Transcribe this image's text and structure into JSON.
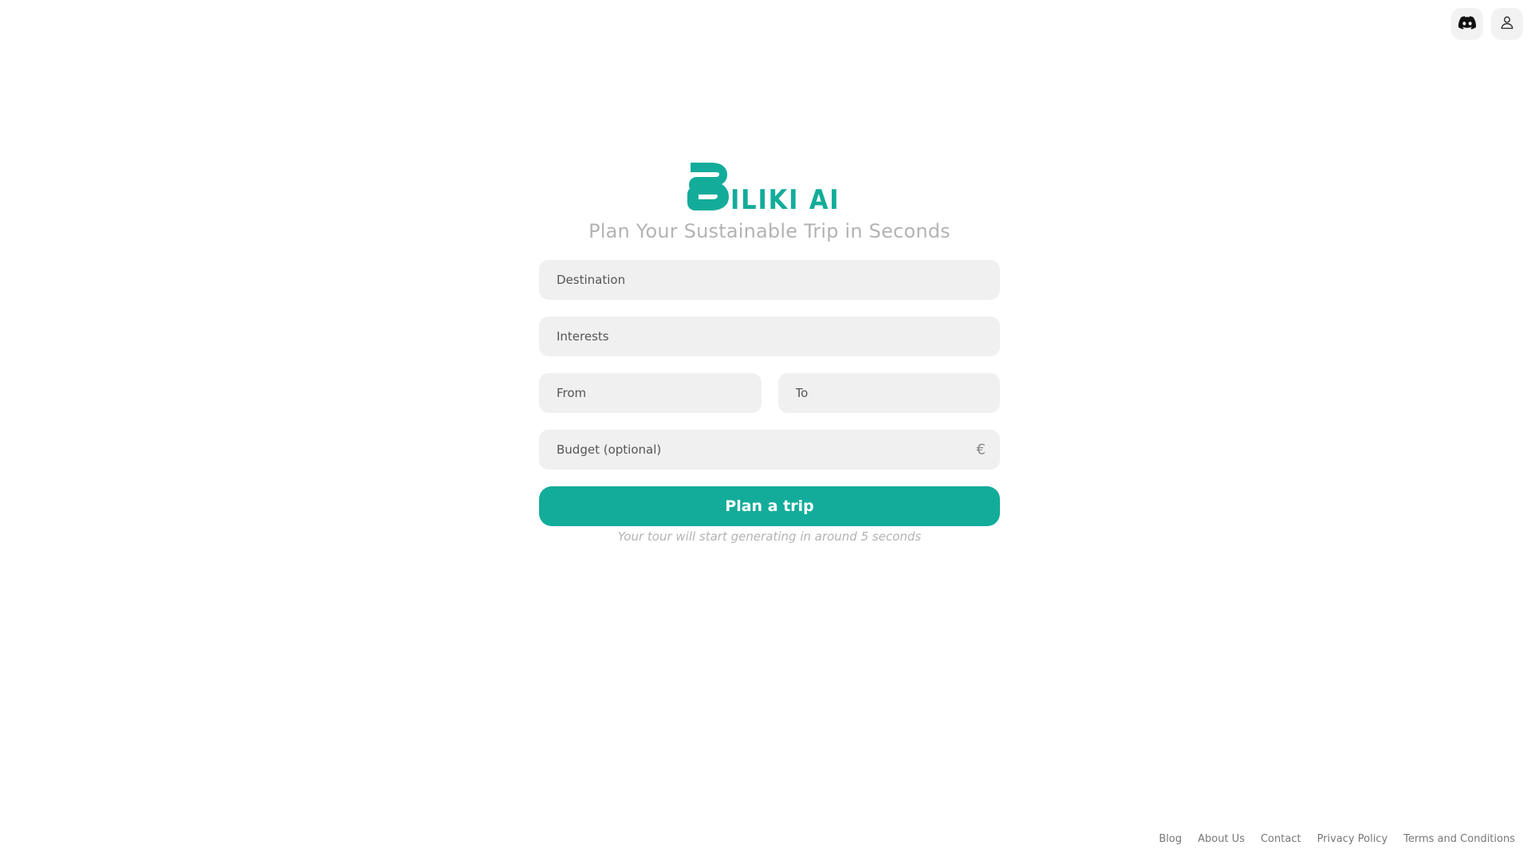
{
  "header": {
    "discord_icon": "discord-icon",
    "user_icon": "user-icon"
  },
  "brand": {
    "logo_text": "ILIKI AI",
    "color": "#13ac9a"
  },
  "hero": {
    "subtitle": "Plan Your Sustainable Trip in Seconds"
  },
  "form": {
    "destination_placeholder": "Destination",
    "interests_placeholder": "Interests",
    "from_placeholder": "From",
    "to_placeholder": "To",
    "budget_placeholder": "Budget (optional)",
    "currency_symbol": "€",
    "submit_label": "Plan a trip",
    "hint": "Your tour will start generating in around 5 seconds"
  },
  "footer": {
    "links": [
      "Blog",
      "About Us",
      "Contact",
      "Privacy Policy",
      "Terms and Conditions"
    ]
  }
}
